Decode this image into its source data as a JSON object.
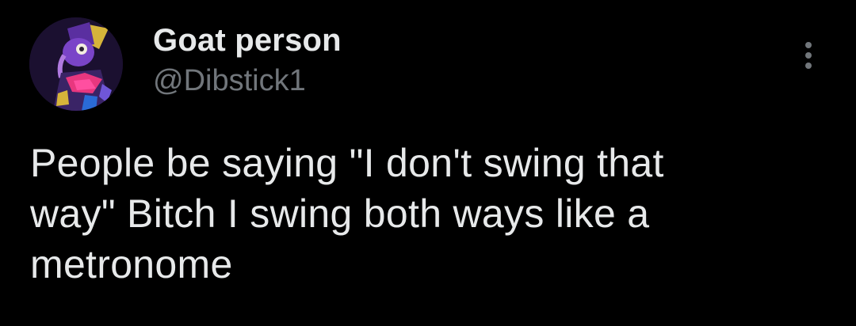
{
  "tweet": {
    "author": {
      "display_name": "Goat person",
      "handle": "@Dibstick1",
      "avatar_icon": "avatar-image"
    },
    "more_icon": "more-options-icon",
    "text": "People be saying \"I don't swing that\nway\" Bitch I swing both ways like a\nmetronome"
  },
  "colors": {
    "background": "#000000",
    "primary_text": "#e7e9ea",
    "secondary_text": "#71767b"
  }
}
